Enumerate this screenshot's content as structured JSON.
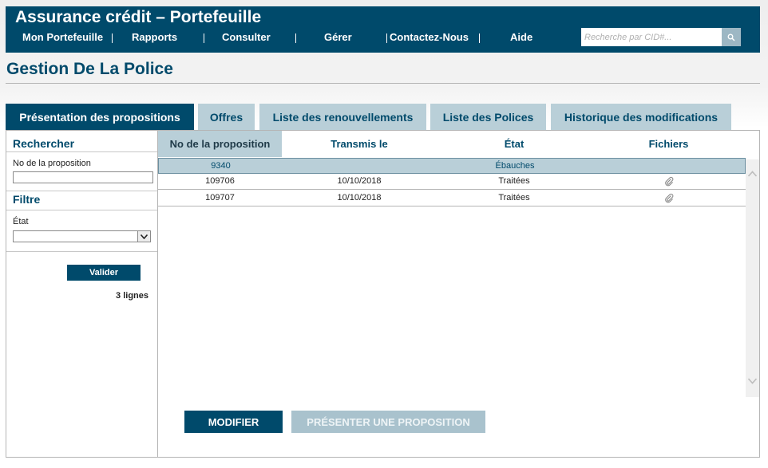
{
  "app": {
    "title": "Assurance crédit – Portefeuille"
  },
  "nav": {
    "items": [
      {
        "label": "Mon Portefeuille"
      },
      {
        "label": "Rapports"
      },
      {
        "label": "Consulter"
      },
      {
        "label": "Gérer"
      },
      {
        "label": "Contactez-Nous"
      },
      {
        "label": "Aide"
      }
    ],
    "search_placeholder": "Recherche par CID#..."
  },
  "page": {
    "title": "Gestion De La Police"
  },
  "tabs": [
    {
      "label": "Présentation des propositions",
      "active": true
    },
    {
      "label": "Offres",
      "active": false
    },
    {
      "label": "Liste des renouvellements",
      "active": false
    },
    {
      "label": "Liste des Polices",
      "active": false
    },
    {
      "label": "Historique des modifications",
      "active": false
    }
  ],
  "sidebar": {
    "search_heading": "Rechercher",
    "proposal_label": "No de la proposition",
    "proposal_value": "",
    "filter_heading": "Filtre",
    "state_label": "État",
    "state_value": "",
    "validate_label": "Valider",
    "row_count": "3 lignes"
  },
  "table": {
    "columns": [
      "No de la proposition",
      "Transmis le",
      "État",
      "Fichiers"
    ],
    "group_row": {
      "proposal": "9340",
      "state": "Ébauches"
    },
    "rows": [
      {
        "proposal": "109706",
        "sent": "10/10/2018",
        "state": "Traitées",
        "file_icon": "paperclip-icon"
      },
      {
        "proposal": "109707",
        "sent": "10/10/2018",
        "state": "Traitées",
        "file_icon": "paperclip-icon"
      }
    ]
  },
  "actions": {
    "modify_label": "MODIFIER",
    "present_label": "PRÉSENTER UNE PROPOSITION"
  },
  "colors": {
    "brand": "#004a6b",
    "tab_inactive": "#b9cfd8",
    "disabled_button": "#a9c2cd"
  }
}
